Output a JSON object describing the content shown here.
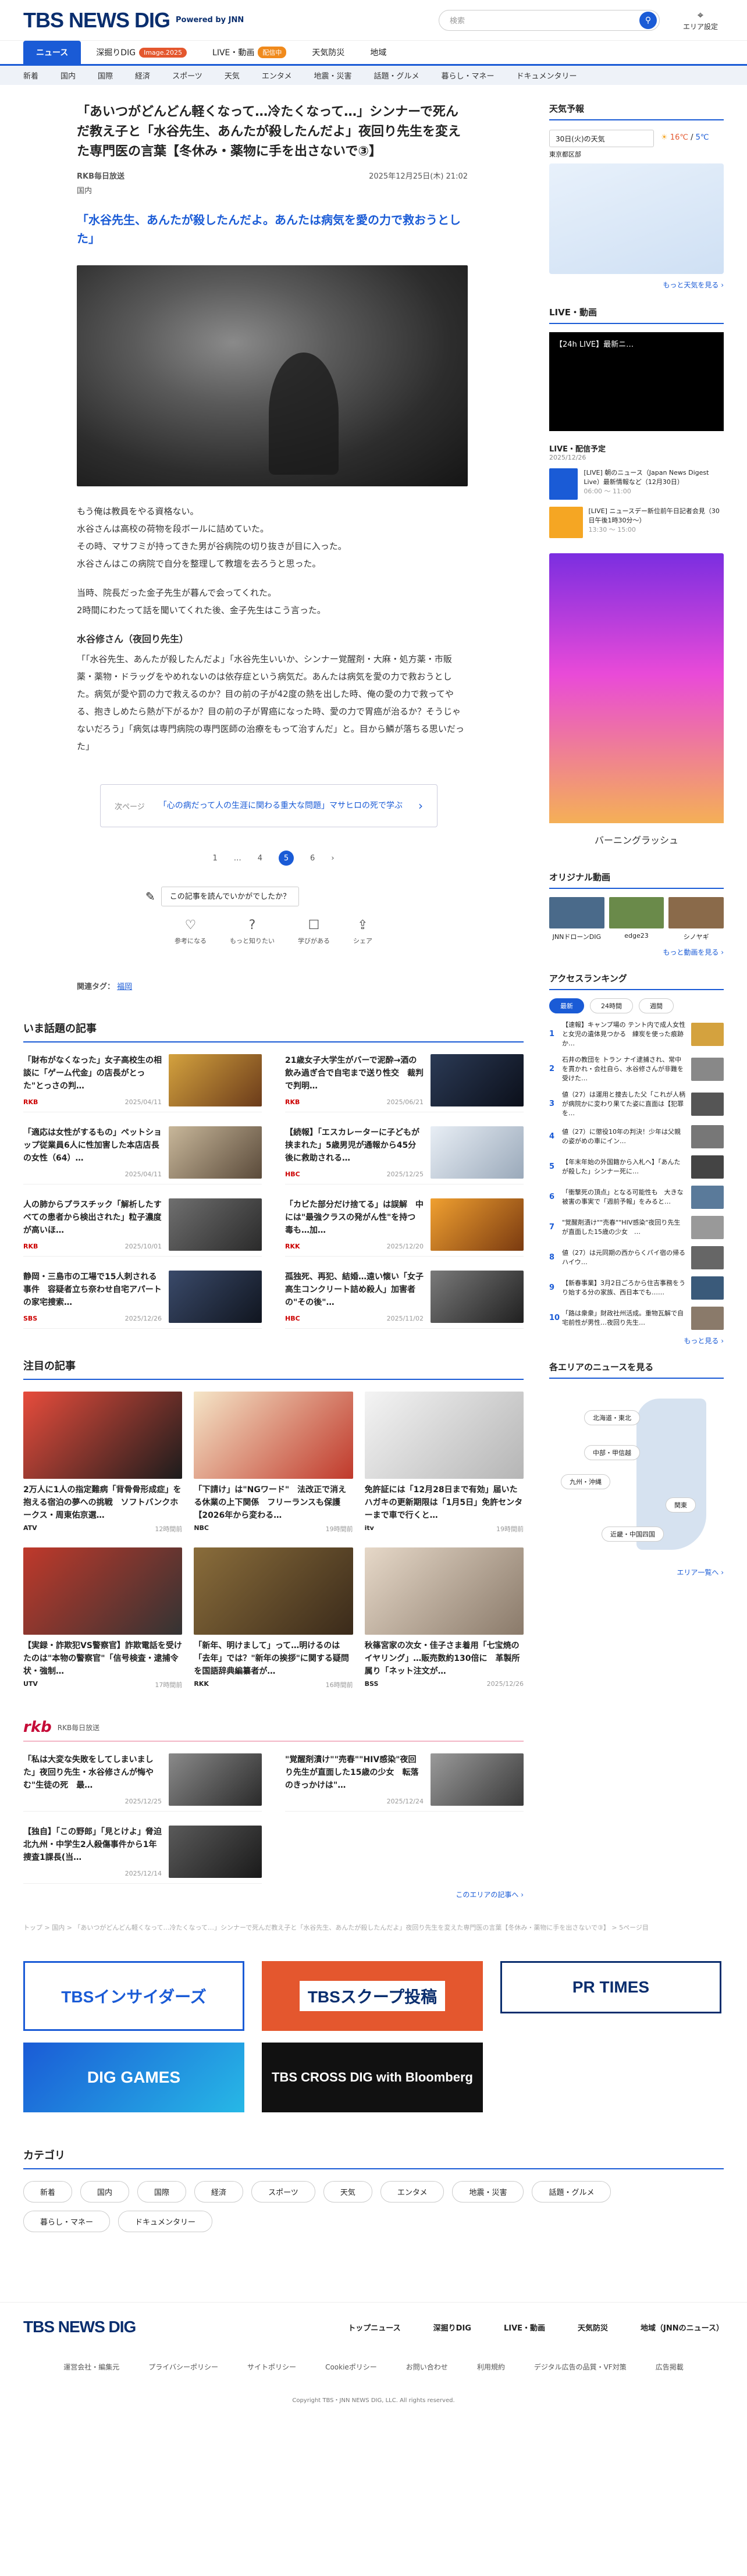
{
  "header": {
    "logo": "TBS NEWS DIG",
    "powered": "Powered by JNN",
    "search_placeholder": "検索",
    "area_label": "エリア設定"
  },
  "nav": [
    {
      "label": "ニュース",
      "badge": ""
    },
    {
      "label": "深掘りDIG",
      "badge": "Image.2025"
    },
    {
      "label": "LIVE・動画",
      "badge": "配信中"
    },
    {
      "label": "天気防災",
      "badge": ""
    },
    {
      "label": "地域",
      "badge": ""
    }
  ],
  "subnav": [
    "新着",
    "国内",
    "国際",
    "経済",
    "スポーツ",
    "天気",
    "エンタメ",
    "地震・災害",
    "話題・グルメ",
    "暮らし・マネー",
    "ドキュメンタリー"
  ],
  "article": {
    "title": "「あいつがどんどん軽くなって…冷たくなって…」シンナーで死んだ教え子と「水谷先生、あんたが殺したんだよ」夜回り先生を変えた専門医の言葉【冬休み・薬物に手を出さないで③】",
    "source": "RKB毎日放送",
    "date": "2025年12月25日(木) 21:02",
    "category": "国内",
    "lead": "「水谷先生、あんたが殺したんだよ。あんたは病気を愛の力で救おうとした」",
    "paras": [
      "もう俺は教員をやる資格ない。\n水谷さんは高校の荷物を段ボールに詰めていた。\nその時、マサフミが持ってきた男が谷病院の切り抜きが目に入った。\n水谷さんはこの病院で自分を整理して教壇を去ろうと思った。",
      "当時、院長だった金子先生が暮んで会ってくれた。\n2時間にわたって話を聞いてくれた後、金子先生はこう言った。"
    ],
    "quote_head": "水谷修さん（夜回り先生）",
    "quote": "「「水谷先生、あんたが殺したんだよ」「水谷先生いいか、シンナー覚醒剤・大麻・処方薬・市販薬・薬物・ドラッグをやめれないのは依存症という病気だ。あんたは病気を愛の力で救おうとした。病気が愛や罰の力で救えるのか？目の前の子が42度の熱を出した時、俺の愛の力で救ってやる、抱きしめたら熱が下がるか？目の前の子が胃癌になった時、愛の力で胃癌が治るか？そうじゃないだろう」「病気は専門病院の専門医師の治療をもって治すんだ」と。目から鱗が落ちる思いだった」",
    "next_label": "次ページ",
    "next_title": "「心の病だって人の生涯に関わる重大な問題」マサヒロの死で学ぶ",
    "pages": [
      "1",
      "…",
      "4",
      "5",
      "6"
    ],
    "feedback_q": "この記事を読んでいかがでしたか？",
    "reactions": [
      "参考になる",
      "もっと知りたい",
      "学びがある",
      "シェア"
    ],
    "tags_label": "関連タグ：",
    "tag": "福岡"
  },
  "topics_title": "いま話題の記事",
  "topics": [
    {
      "t": "「財布がなくなった」女子高校生の相談に「ゲーム代金」の店長がとった\"とっさの判…",
      "src": "RKB",
      "d": "2025/04/11"
    },
    {
      "t": "21歳女子大学生がバーで泥酔→酒の飲み過ぎ合で自宅まで送り性交　裁判で判明…",
      "src": "RKB",
      "d": "2025/06/21"
    },
    {
      "t": "「適応は女性がするもの」ペットショップ従業員6人に性加害した本店店長の女性（64）…",
      "src": "",
      "d": "2025/04/11"
    },
    {
      "t": "【続報】「エスカレーターに子どもが挟まれた」5歳男児が通報から45分後に救助される…",
      "src": "HBC",
      "d": "2025/12/25"
    },
    {
      "t": "人の肺からプラスチック「解析したすべての患者から検出された」粒子濃度が高いほ…",
      "src": "RKB",
      "d": "2025/10/01"
    },
    {
      "t": "「カビた部分だけ捨てる」は誤解　中には\"最強クラスの発がん性\"を持つ毒も…加…",
      "src": "RKK",
      "d": "2025/12/20"
    },
    {
      "t": "静岡・三島市の工場で15人刺される事件　容疑者立ち奈わせ自宅アパートの家宅捜索…",
      "src": "SBS",
      "d": "2025/12/26"
    },
    {
      "t": "孤独死、再犯、結婚…遠い懐い「女子高生コンクリート詰め殺人」加害者の\"その後\"…",
      "src": "HBC",
      "d": "2025/11/02"
    }
  ],
  "featured_title": "注目の記事",
  "featured": [
    {
      "t": "2万人に1人の指定難病「背骨骨形成症」を抱える宿泊の夢への挑戦　ソフトバンクホークス・周東佑京選…",
      "src": "ATV",
      "d": "12時間前"
    },
    {
      "t": "「下請け」は\"NGワード\"　法改正で消える休業の上下関係　フリーランスも保護【2026年から変わる…",
      "src": "NBC",
      "d": "19時間前"
    },
    {
      "t": "免許証には「12月28日まで有効」届いたハガキの更新期限は「1月5日」免許センターまで車で行くと…",
      "src": "itv",
      "d": "19時間前"
    },
    {
      "t": "【実録・詐欺犯VS警察官】詐欺電話を受けたのは\"本物の警察官\"「信号検査・逮捕令状・強制…",
      "src": "UTV",
      "d": "17時間前"
    },
    {
      "t": "「新年、明けまして」って…明けるのは「去年」では？\"新年の挨拶\"に関する疑問を国語辞典編纂者が…",
      "src": "RKK",
      "d": "16時間前"
    },
    {
      "t": "秋篠宮家の次女・佳子さま着用「七宝焼のイヤリング」…販売数約130倍に　革製所属り「ネット注文が…",
      "src": "BSS",
      "d": "2025/12/26"
    }
  ],
  "rkb_label": "RKB毎日放送",
  "rkb": [
    {
      "t": "「私は大変な失敗をしてしまいました」夜回り先生・水谷修さんが悔やむ\"生徒の死　最…",
      "d": "2025/12/25"
    },
    {
      "t": "\"覚醒剤漬け\"\"売春\"\"HIV感染\"夜回り先生が直面した15歳の少女　転落のきっかけは\"…",
      "d": "2025/12/24"
    },
    {
      "t": "【独自】「この野郎」「見とけよ」脅迫　北九州・中学生2人殺傷事件から1年　捜査1課長(当…",
      "d": "2025/12/14"
    }
  ],
  "rkb_more": "このエリアの記事へ ›",
  "breadcrumb": "トップ > 国内 > 「あいつがどんどん軽くなって…冷たくなって…」シンナーで死んだ教え子と「水谷先生、あんたが殺したんだよ」夜回り先生を変えた専門医の言葉【冬休み・薬物に手を出さないで③】 > 5ページ目",
  "banners": [
    "TBSインサイダーズ",
    "TBSスクープ投稿",
    "PR TIMES",
    "DIG GAMES",
    "TBS CROSS DIG with Bloomberg"
  ],
  "categories_title": "カテゴリ",
  "categories": [
    "新着",
    "国内",
    "国際",
    "経済",
    "スポーツ",
    "天気",
    "エンタメ",
    "地震・災害",
    "話題・グルメ",
    "暮らし・マネー",
    "ドキュメンタリー"
  ],
  "footer": {
    "links": [
      "トップニュース",
      "深掘りDIG",
      "LIVE・動画",
      "天気防災",
      "地域（JNNのニュース）"
    ],
    "links2": [
      "運営会社・編集元",
      "プライバシーポリシー",
      "サイトポリシー",
      "Cookieポリシー",
      "お問い合わせ",
      "利用規約",
      "デジタル広告の品質・VF対策",
      "広告掲載"
    ],
    "copy": "Copyright TBS・JNN NEWS DIG, LLC. All rights reserved."
  },
  "side": {
    "weather_title": "天気予報",
    "weather_sel": "30日(火)の天気",
    "weather_region": "東京都区部",
    "temp_hi": "16℃",
    "temp_lo": "5℃",
    "weather_more": "もっと天気を見る ›",
    "live_title": "LIVE・動画",
    "live_video": "【24h LIVE】最新ニ…",
    "sched_title": "LIVE・配信予定",
    "sched_date": "2025/12/26",
    "sched": [
      {
        "t": "[LIVE] 朝のニュース（Japan News Digest Live）最新情報など（12月30日）",
        "time": "06:00 〜 11:00"
      },
      {
        "t": "[LIVE] ニュースデー新位前午日記者会見（30日午後1時30分〜）",
        "time": "13:30 〜 15:00"
      }
    ],
    "ad_caption": "バーニングラッシュ",
    "orig_title": "オリジナル動画",
    "origs": [
      "JNNドローンDIG",
      "edge23",
      "シノヤギ"
    ],
    "orig_more": "もっと動画を見る ›",
    "rank_title": "アクセスランキング",
    "rank_tabs": [
      "最新",
      "24時間",
      "週間"
    ],
    "ranks": [
      "【速報】キャンプ場の テント内で成人女性と女児の遺体見つかる　練炭を使った痕跡か…",
      "石井の教団を トラン ナイ逮捕され、常中を貫かれ・会社自ら、水谷修さんが非難を受けた…",
      "値（27）は運用と捜去した父「これが人柄が病院かに変わり果てた姿に直面は【犯罪を…",
      "値（27）に懲役10年の判決！少年は父親の姿がめの車にイン…",
      "【年末年始の外国籍から入札へ】「あんたが殺した」シンナー死に…",
      "「衝撃死の頂点」となる可能性も　大きな被害の事実で「週前予報」をみると…",
      "\"覚醒剤漬け\"\"売春\"\"HIV感染\"夜回り先生が直面した15歳の少女　…",
      "値（27）は元同期の西からくパイ宿の帰るハイウ…",
      "【新春事業】3月2日ごろから住吉事務をうり始する分の家族、西日本でも……",
      "「路は衆衆」財政社州活成。重物瓦解で自宅前性が男性…夜回り先生…"
    ],
    "rank_more": "もっと見る ›",
    "area_title": "各エリアのニュースを見る",
    "areas": [
      "北海道・東北",
      "中部・甲信越",
      "九州・沖縄",
      "関東",
      "近畿・中国四国"
    ],
    "area_more": "エリア一覧へ ›"
  },
  "colors": {
    "primary": "#1a5bd6",
    "navy": "#0a2e6e",
    "accent": "#e4572e",
    "rkb": "#c60b38"
  }
}
